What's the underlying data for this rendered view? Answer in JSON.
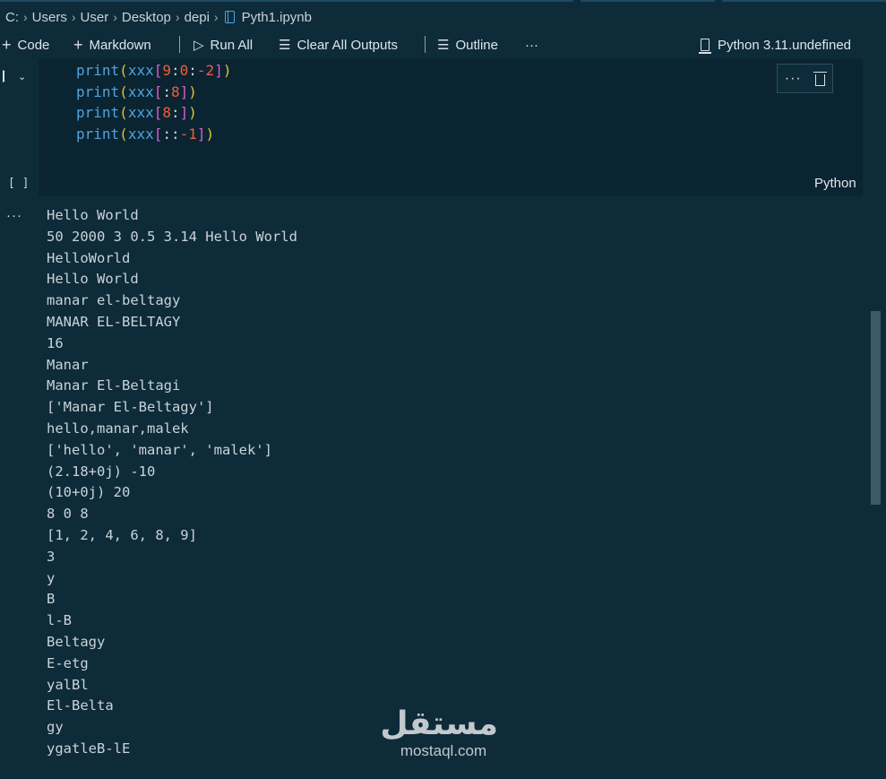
{
  "breadcrumb": {
    "drive": "C:",
    "parts": [
      "Users",
      "User",
      "Desktop",
      "depi"
    ],
    "file": "Pyth1.ipynb"
  },
  "toolbar": {
    "code_label": "Code",
    "markdown_label": "Markdown",
    "run_all_label": "Run All",
    "clear_label": "Clear All Outputs",
    "outline_label": "Outline",
    "more_label": "···",
    "kernel_label": "Python 3.11.undefined"
  },
  "cell": {
    "code_lines": [
      [
        "print",
        "(",
        "xxx",
        "[",
        "9",
        ":",
        "0",
        ":",
        "-2",
        "]",
        ")"
      ],
      [
        "print",
        "(",
        "xxx",
        "[",
        ":",
        "8",
        "]",
        ")"
      ],
      [
        "print",
        "(",
        "xxx",
        "[",
        "8",
        ":",
        "]",
        ")"
      ],
      [
        "print",
        "(",
        "xxx",
        "[",
        "::",
        "-1",
        "]",
        ")"
      ]
    ],
    "exec_count": "[ ]",
    "language": "Python",
    "toolbar_more": "···"
  },
  "output": {
    "more": "···",
    "lines": [
      "Hello World",
      "50 2000 3 0.5 3.14 Hello World",
      "HelloWorld",
      "Hello World",
      "manar el-beltagy",
      "MANAR EL-BELTAGY",
      "16",
      "Manar",
      "Manar El-Beltagi",
      "['Manar El-Beltagy']",
      "hello,manar,malek",
      "['hello', 'manar', 'malek']",
      "(2.18+0j) -10",
      "(10+0j) 20",
      "8 0 8",
      "[1, 2, 4, 6, 8, 9]",
      "3",
      "y",
      "B",
      "l-B",
      "Beltagy",
      "E-etg",
      "yalBl",
      "El-Belta",
      "gy",
      "ygatleB-lE"
    ]
  },
  "watermark": {
    "arabic": "مستقل",
    "latin": "mostaql.com"
  }
}
